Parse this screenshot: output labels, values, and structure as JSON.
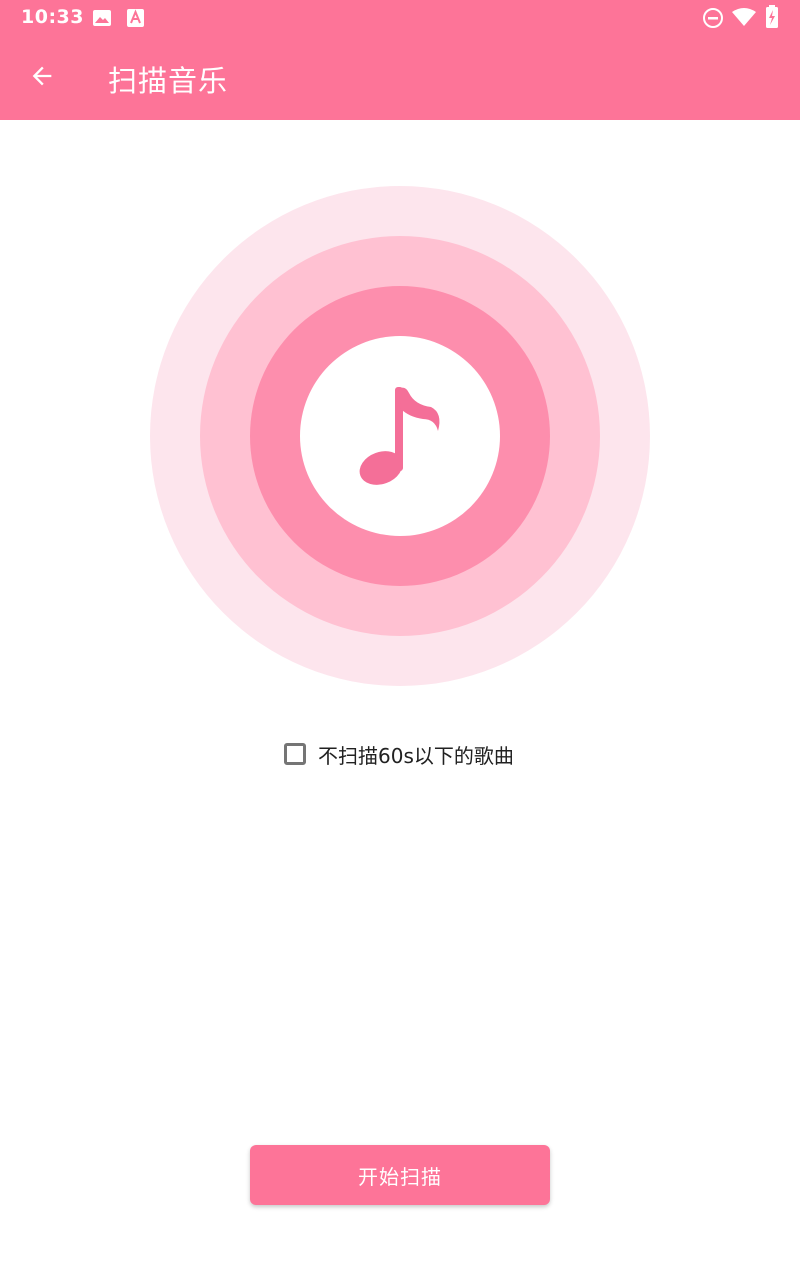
{
  "status_bar": {
    "time": "10:33",
    "left_icons": [
      "image-icon",
      "font-a-icon"
    ],
    "right_icons": [
      "do-not-disturb-icon",
      "wifi-icon",
      "battery-charging-icon"
    ]
  },
  "app_bar": {
    "back_icon": "arrow-back-icon",
    "title": "扫描音乐"
  },
  "scan_visual": {
    "icon": "music-note-icon"
  },
  "option": {
    "checked": false,
    "label": "不扫描60s以下的歌曲"
  },
  "actions": {
    "start_label": "开始扫描"
  },
  "colors": {
    "primary": "#fd7498",
    "ring_outer": "#fde5ed",
    "ring_middle": "#ffc1d2",
    "ring_inner": "#fd8ead",
    "note": "#f46f98"
  }
}
